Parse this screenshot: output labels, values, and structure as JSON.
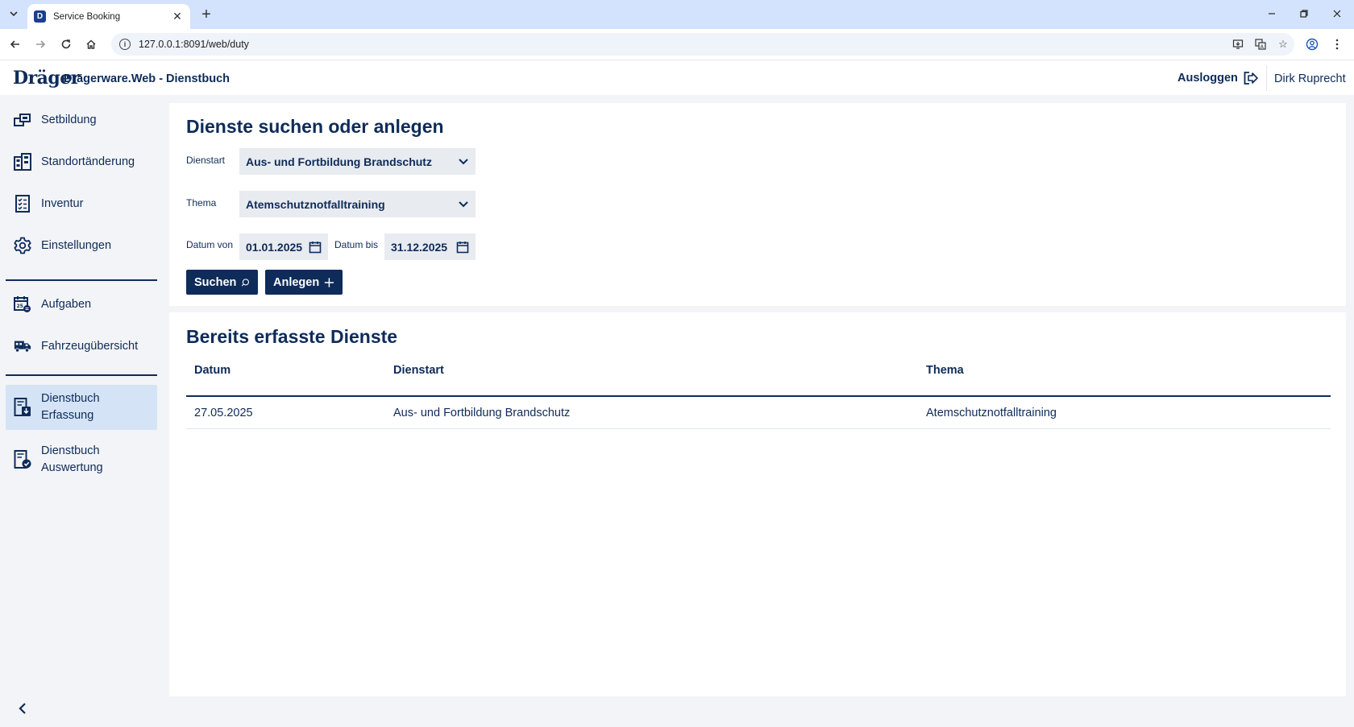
{
  "browser": {
    "tab_title": "Service Booking",
    "tab_favicon": "D",
    "url": "127.0.0.1:8091/web/duty"
  },
  "header": {
    "logo": "Dräger",
    "title": "Drägerware.Web - Dienstbuch",
    "logout_label": "Ausloggen",
    "user_name": "Dirk Ruprecht"
  },
  "sidebar": {
    "items": [
      {
        "label": "Setbildung",
        "icon": "set-icon"
      },
      {
        "label": "Standortänderung",
        "icon": "building-icon"
      },
      {
        "label": "Inventur",
        "icon": "checklist-icon"
      },
      {
        "label": "Einstellungen",
        "icon": "gear-icon"
      },
      {
        "label": "Aufgaben",
        "icon": "calendar-task-icon"
      },
      {
        "label": "Fahrzeugübersicht",
        "icon": "truck-icon"
      },
      {
        "label_line1": "Dienstbuch",
        "label_line2": "Erfassung",
        "icon": "book-download-icon",
        "active": true
      },
      {
        "label_line1": "Dienstbuch",
        "label_line2": "Auswertung",
        "icon": "book-check-icon"
      }
    ]
  },
  "search": {
    "title": "Dienste suchen oder anlegen",
    "dienstart_label": "Dienstart",
    "dienstart_value": "Aus- und Fortbildung Brandschutz",
    "thema_label": "Thema",
    "thema_value": "Atemschutznotfalltraining",
    "datum_von_label": "Datum von",
    "datum_von_value": "01.01.2025",
    "datum_bis_label": "Datum bis",
    "datum_bis_value": "31.12.2025",
    "search_button": "Suchen",
    "create_button": "Anlegen"
  },
  "list": {
    "title": "Bereits erfasste Dienste",
    "columns": [
      "Datum",
      "Dienstart",
      "Thema"
    ],
    "rows": [
      {
        "datum": "27.05.2025",
        "dienstart": "Aus- und Fortbildung Brandschutz",
        "thema": "Atemschutznotfalltraining"
      }
    ]
  },
  "colors": {
    "brand_navy": "#0e2b59",
    "active_nav_bg": "#d4e4f6",
    "page_bg": "#f3f4f7"
  }
}
